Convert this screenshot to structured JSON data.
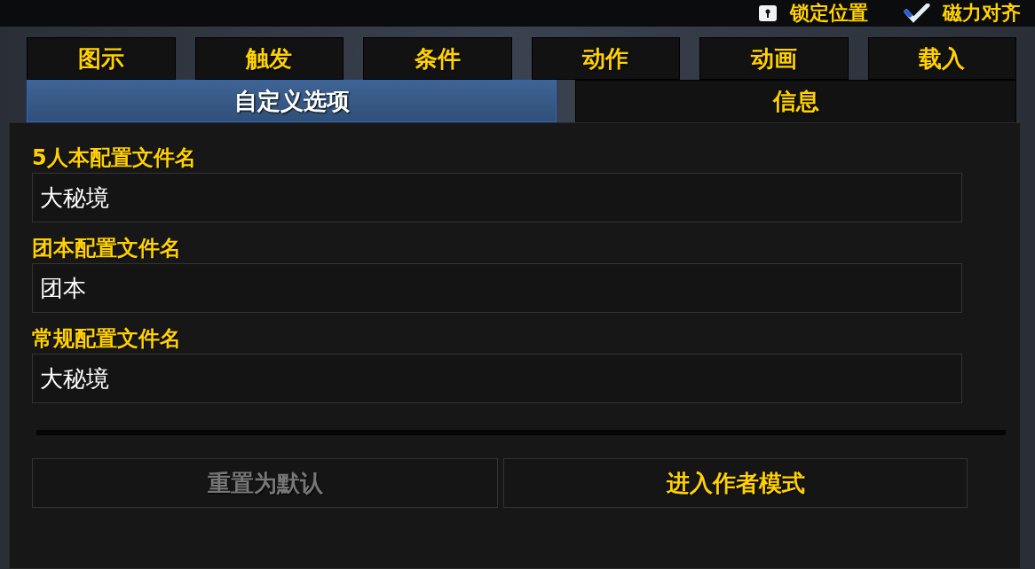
{
  "toolbar": [
    {
      "kind": "lock",
      "label": "锁定位置"
    },
    {
      "kind": "checkbox",
      "label": "磁力对齐",
      "checked": true
    }
  ],
  "tab_rows": [
    [
      {
        "label": "图示",
        "selected": false
      },
      {
        "label": "触发",
        "selected": false
      },
      {
        "label": "条件",
        "selected": false
      },
      {
        "label": "动作",
        "selected": false
      },
      {
        "label": "动画",
        "selected": false
      },
      {
        "label": "载入",
        "selected": false
      }
    ],
    [
      {
        "label": "自定义选项",
        "selected": true
      },
      {
        "label": "信息",
        "selected": false
      }
    ]
  ],
  "fields": [
    {
      "label": "5人本配置文件名",
      "value": "大秘境"
    },
    {
      "label": "团本配置文件名",
      "value": "团本"
    },
    {
      "label": "常规配置文件名",
      "value": "大秘境"
    }
  ],
  "buttons": [
    {
      "label": "重置为默认",
      "disabled": true
    },
    {
      "label": "进入作者模式",
      "disabled": false
    }
  ]
}
